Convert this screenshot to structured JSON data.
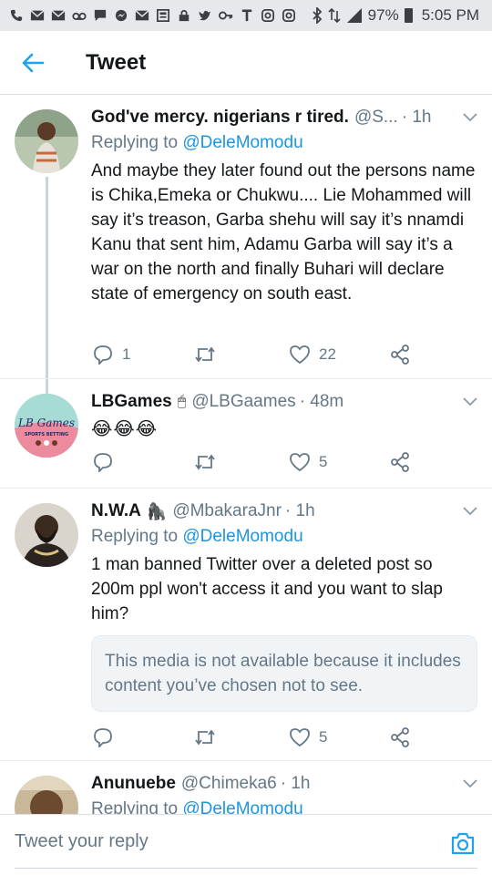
{
  "status_bar": {
    "battery": "97%",
    "time": "5:05 PM",
    "icons": [
      "phone-icon",
      "mail-icon",
      "mail-icon",
      "voicemail-icon",
      "chat-icon",
      "messenger-icon",
      "mail-icon",
      "news-icon",
      "lock-icon",
      "twitter-icon",
      "key-icon",
      "t-icon",
      "instagram-icon",
      "instagram-icon",
      "bluetooth-icon",
      "signal-icon",
      "battery-icon"
    ]
  },
  "header": {
    "title": "Tweet",
    "back_icon": "arrow-left-icon"
  },
  "tweets": [
    {
      "name": "God've mercy. nigerians r tired.",
      "handle": "@S...",
      "time": "· 1h",
      "replying_prefix": "Replying to",
      "replying_to": "@DeleMomodu",
      "text": "And maybe they later found out the persons name is Chika,Emeka or Chukwu.... Lie Mohammed will say it’s treason, Garba shehu will say it’s nnamdi Kanu that sent him, Adamu Garba will say it’s a war on the north and finally Buhari will declare state of emergency on south east.",
      "replies": "1",
      "retweets": "",
      "likes": "22"
    },
    {
      "name": "LBGames",
      "badge": "🖱",
      "handle": "@LBGaames",
      "time": "· 48m",
      "text": "😂😂😂",
      "avatar_text": "LB Games",
      "avatar_sub": "SPORTS BETTING",
      "replies": "",
      "retweets": "",
      "likes": "5"
    },
    {
      "name": "N.W.A",
      "badge": "🦍",
      "handle": "@MbakaraJnr",
      "time": "· 1h",
      "replying_prefix": "Replying to",
      "replying_to": "@DeleMomodu",
      "text": "1 man banned Twitter over a deleted post so 200m ppl won't access it and you want to slap him?",
      "media_notice": "This media is not available because it includes content you’ve chosen not to see.",
      "replies": "",
      "retweets": "",
      "likes": "5"
    },
    {
      "name": "Anunuebe",
      "handle": "@Chimeka6",
      "time": "· 1h",
      "replying_prefix": "Replying to",
      "replying_to": "@DeleMomodu"
    }
  ],
  "reply_bar": {
    "placeholder": "Tweet your reply",
    "camera_icon": "camera-icon"
  },
  "colors": {
    "accent": "#1da1f2",
    "mention": "#1b95e0",
    "secondary_text": "#657786",
    "status_bar": "#e6e9ec"
  }
}
